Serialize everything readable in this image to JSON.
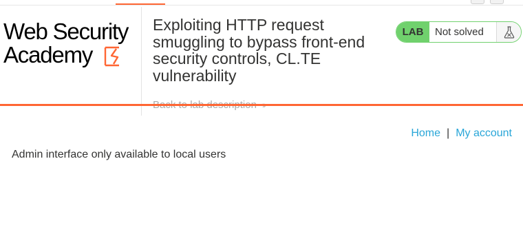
{
  "header": {
    "logo": {
      "line1": "Web Security",
      "line2": "Academy"
    },
    "lab_title": "Exploiting HTTP request smuggling to bypass front-end security controls, CL.TE vulnerability",
    "back_link": "Back to lab description",
    "lab_status": {
      "badge": "LAB",
      "state": "Not solved",
      "icon": "flask-icon"
    }
  },
  "nav": {
    "home": "Home",
    "separator": "|",
    "account": "My account"
  },
  "main": {
    "message": "Admin interface only available to local users"
  },
  "colors": {
    "accent": "#ff6633",
    "status_green": "#70d16d",
    "link": "#29a6d8"
  }
}
